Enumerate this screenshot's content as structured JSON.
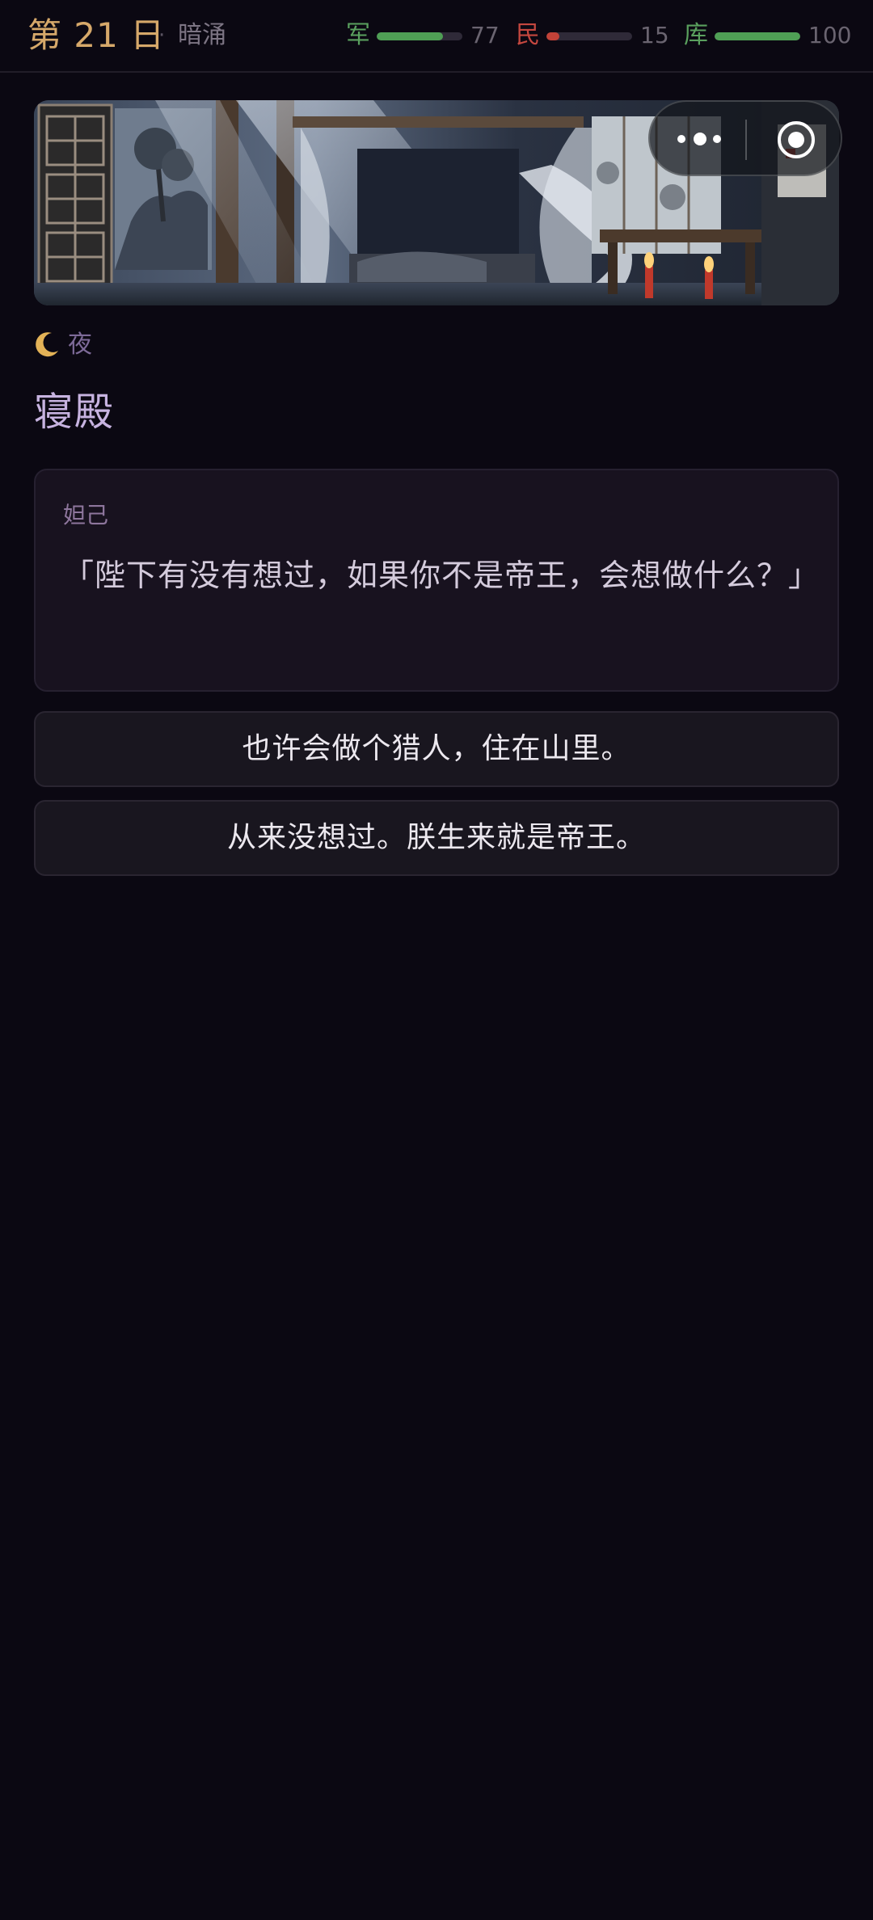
{
  "header": {
    "day_title": "第 21 日",
    "separator": "·",
    "phase": "暗涌",
    "stats": [
      {
        "label": "军",
        "value": "77",
        "level": 0.77,
        "label_color": "#5aa05e",
        "bar_color": "#4f9f55"
      },
      {
        "label": "民",
        "value": "15",
        "level": 0.15,
        "label_color": "#c4473f",
        "bar_color": "#c24238"
      },
      {
        "label": "库",
        "value": "100",
        "level": 1.0,
        "label_color": "#5aa05e",
        "bar_color": "#4f9f55"
      }
    ]
  },
  "scene": {
    "image_icon": "palace-bedchamber-illustration",
    "time_icon": "crescent-moon-icon",
    "time_label": "夜",
    "location": "寝殿"
  },
  "capsule": {
    "more_icon": "more-dots-icon",
    "close_icon": "target-close-icon"
  },
  "dialogue": {
    "speaker": "妲己",
    "text": "「陛下有没有想过，如果你不是帝王，会想做什么？」"
  },
  "choices": [
    {
      "label": "也许会做个猎人，住在山里。"
    },
    {
      "label": "从来没想过。朕生来就是帝王。"
    }
  ],
  "colors": {
    "background": "#0b0812",
    "accent_gold": "#d6a86a",
    "location_purple": "#c7b3e0"
  }
}
